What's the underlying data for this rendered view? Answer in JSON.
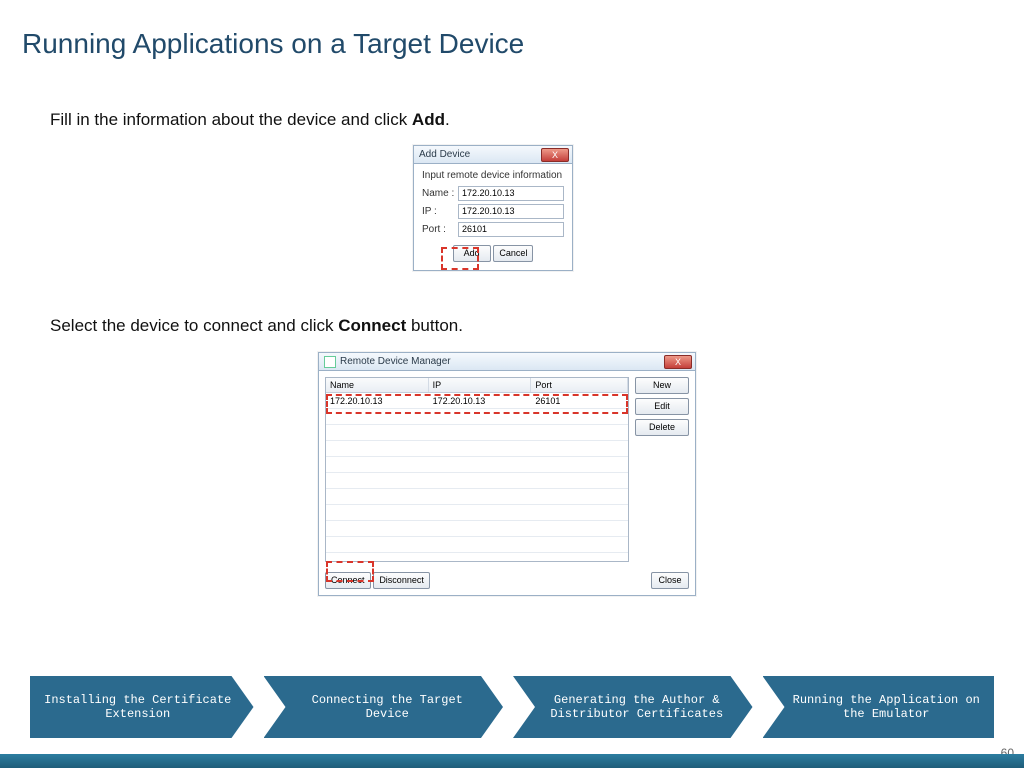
{
  "title": "Running Applications on a Target Device",
  "instruction1_pre": "Fill in the information about the device and click ",
  "instruction1_bold": "Add",
  "instruction1_post": ".",
  "instruction2_pre": "Select the device to connect and click ",
  "instruction2_bold": "Connect",
  "instruction2_post": " button.",
  "add_dialog": {
    "title": "Add Device",
    "close": "X",
    "heading": "Input remote device information",
    "name_label": "Name :",
    "name_value": "172.20.10.13",
    "ip_label": "IP :",
    "ip_value": "172.20.10.13",
    "port_label": "Port :",
    "port_value": "26101",
    "add_btn": "Add",
    "cancel_btn": "Cancel"
  },
  "mgr_dialog": {
    "title": "Remote Device Manager",
    "close": "X",
    "col_name": "Name",
    "col_ip": "IP",
    "col_port": "Port",
    "row_name": "172.20.10.13",
    "row_ip": "172.20.10.13",
    "row_port": "26101",
    "btn_new": "New",
    "btn_edit": "Edit",
    "btn_delete": "Delete",
    "btn_connect": "Connect",
    "btn_disconnect": "Disconnect",
    "btn_close": "Close"
  },
  "steps": {
    "s1": "Installing the Certificate Extension",
    "s2": "Connecting the Target Device",
    "s3": "Generating the Author & Distributor Certificates",
    "s4": "Running the Application on the Emulator"
  },
  "page_num": "60"
}
